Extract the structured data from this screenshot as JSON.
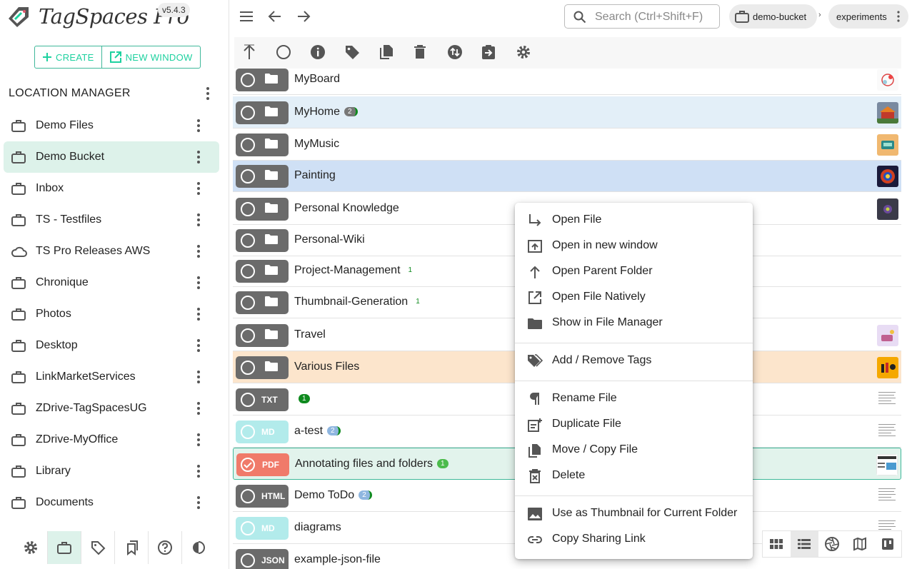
{
  "app": {
    "name": "TagSpaces Pro",
    "version": "v5.4.3"
  },
  "actions": {
    "create": "CREATE",
    "new_window": "NEW WINDOW"
  },
  "location_manager": {
    "title": "LOCATION MANAGER",
    "locations": [
      {
        "label": "Demo Files",
        "icon": "briefcase-icon",
        "selected": false
      },
      {
        "label": "Demo Bucket",
        "icon": "briefcase-icon",
        "selected": true
      },
      {
        "label": "Inbox",
        "icon": "briefcase-icon",
        "selected": false
      },
      {
        "label": "TS - Testfiles",
        "icon": "briefcase-icon",
        "selected": false
      },
      {
        "label": "TS Pro Releases AWS",
        "icon": "cloud-icon",
        "selected": false
      },
      {
        "label": "Chronique",
        "icon": "briefcase-icon",
        "selected": false
      },
      {
        "label": "Photos",
        "icon": "briefcase-icon",
        "selected": false
      },
      {
        "label": "Desktop",
        "icon": "briefcase-icon",
        "selected": false
      },
      {
        "label": "LinkMarketServices",
        "icon": "briefcase-icon",
        "selected": false
      },
      {
        "label": "ZDrive-TagSpacesUG",
        "icon": "briefcase-icon",
        "selected": false
      },
      {
        "label": "ZDrive-MyOffice",
        "icon": "briefcase-icon",
        "selected": false
      },
      {
        "label": "Library",
        "icon": "briefcase-icon",
        "selected": false
      },
      {
        "label": "Documents",
        "icon": "briefcase-icon",
        "selected": false
      }
    ]
  },
  "search": {
    "placeholder": "Search (Ctrl+Shift+F)"
  },
  "breadcrumb": {
    "location": "demo-bucket",
    "folder": "experiments"
  },
  "files": [
    {
      "name": "MyBoard",
      "type": "folder",
      "tag_count": "",
      "thumb": "board"
    },
    {
      "name": "MyHome",
      "type": "folder",
      "tag_count": "2",
      "thumb": "home"
    },
    {
      "name": "MyMusic",
      "type": "folder",
      "tag_count": "",
      "thumb": "music"
    },
    {
      "name": "Painting",
      "type": "folder",
      "tag_count": "",
      "thumb": "painting"
    },
    {
      "name": "Personal Knowledge",
      "type": "folder",
      "tag_count": "",
      "thumb": "dark"
    },
    {
      "name": "Personal-Wiki",
      "type": "folder",
      "tag_count": "",
      "thumb": ""
    },
    {
      "name": "Project-Management",
      "type": "folder",
      "tag_count": "1",
      "thumb": ""
    },
    {
      "name": "Thumbnail-Generation",
      "type": "folder",
      "tag_count": "1",
      "thumb": ""
    },
    {
      "name": "Travel",
      "type": "folder",
      "tag_count": "",
      "thumb": "travel"
    },
    {
      "name": "Various Files",
      "type": "folder",
      "tag_count": "",
      "thumb": "various"
    },
    {
      "name": "",
      "type": "TXT",
      "tag_count": "1",
      "thumb": "doc"
    },
    {
      "name": "a-test",
      "type": "MD",
      "tag_count": "2",
      "thumb": "doc"
    },
    {
      "name": "Annotating files and folders",
      "type": "PDF",
      "tag_count": "1",
      "thumb": "pdf"
    },
    {
      "name": "Demo ToDo",
      "type": "HTML",
      "tag_count": "2",
      "thumb": "doc"
    },
    {
      "name": "diagrams",
      "type": "MD",
      "tag_count": "",
      "thumb": "doc"
    },
    {
      "name": "example-json-file",
      "type": "JSON",
      "tag_count": "",
      "thumb": ""
    }
  ],
  "context_menu": {
    "items": [
      {
        "label": "Open File",
        "icon": "open-file-icon"
      },
      {
        "label": "Open in new window",
        "icon": "open-in-new-window-icon"
      },
      {
        "label": "Open Parent Folder",
        "icon": "arrow-up-icon"
      },
      {
        "label": "Open File Natively",
        "icon": "external-link-icon"
      },
      {
        "label": "Show in File Manager",
        "icon": "folder-icon"
      },
      {
        "label": "Add / Remove Tags",
        "icon": "tags-icon"
      },
      {
        "label": "Rename File",
        "icon": "pilcrow-icon"
      },
      {
        "label": "Duplicate File",
        "icon": "duplicate-icon"
      },
      {
        "label": "Move / Copy File",
        "icon": "copy-icon"
      },
      {
        "label": "Delete",
        "icon": "delete-icon"
      },
      {
        "label": "Use as Thumbnail for Current Folder",
        "icon": "image-icon"
      },
      {
        "label": "Copy Sharing Link",
        "icon": "link-icon"
      }
    ]
  },
  "colors": {
    "accent": "#1dd19f",
    "selected_location_bg": "#ddf2ea",
    "folder_chip": "#6b6b6b",
    "md_chip": "#b2ebeb",
    "pdf_chip": "#f07a6a",
    "tag_green": "#0f8a1e",
    "tag_blue": "#8fb6e0"
  }
}
